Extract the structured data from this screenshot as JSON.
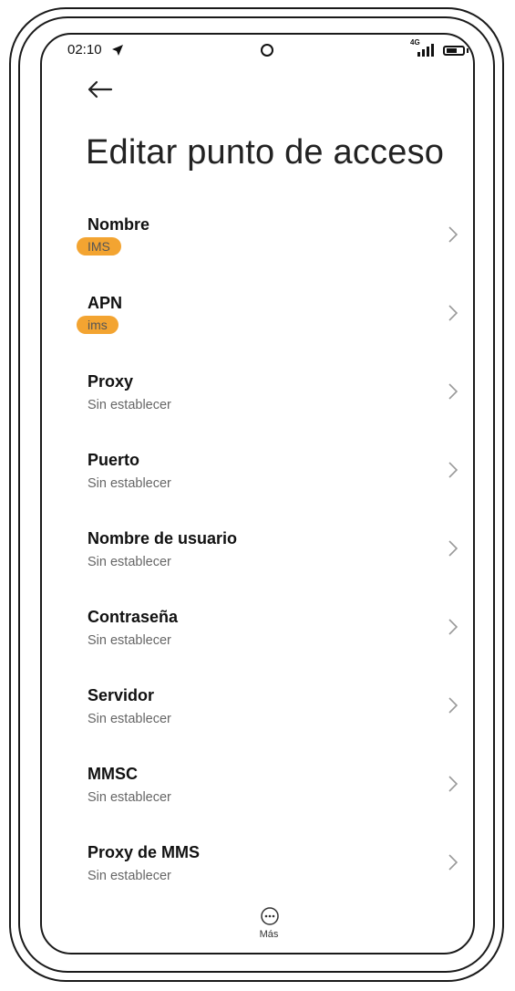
{
  "status_bar": {
    "time": "02:10",
    "network": "4G",
    "icons": [
      "location-arrow-icon",
      "camera-icon",
      "signal-icon",
      "battery-icon"
    ]
  },
  "header": {
    "back_icon": "arrow-left-icon",
    "title": "Editar punto de acceso"
  },
  "settings": [
    {
      "label": "Nombre",
      "value": "IMS",
      "highlight": true
    },
    {
      "label": "APN",
      "value": "ims",
      "highlight": true
    },
    {
      "label": "Proxy",
      "value": "Sin establecer"
    },
    {
      "label": "Puerto",
      "value": "Sin establecer"
    },
    {
      "label": "Nombre de usuario",
      "value": "Sin establecer"
    },
    {
      "label": "Contraseña",
      "value": "Sin establecer"
    },
    {
      "label": "Servidor",
      "value": "Sin establecer"
    },
    {
      "label": "MMSC",
      "value": "Sin establecer"
    },
    {
      "label": "Proxy de MMS",
      "value": "Sin establecer"
    }
  ],
  "footer": {
    "more_label": "Más",
    "more_icon": "more-dots-icon"
  },
  "colors": {
    "highlight": "#f3a431",
    "text_primary": "#111111",
    "text_secondary": "#666666"
  }
}
